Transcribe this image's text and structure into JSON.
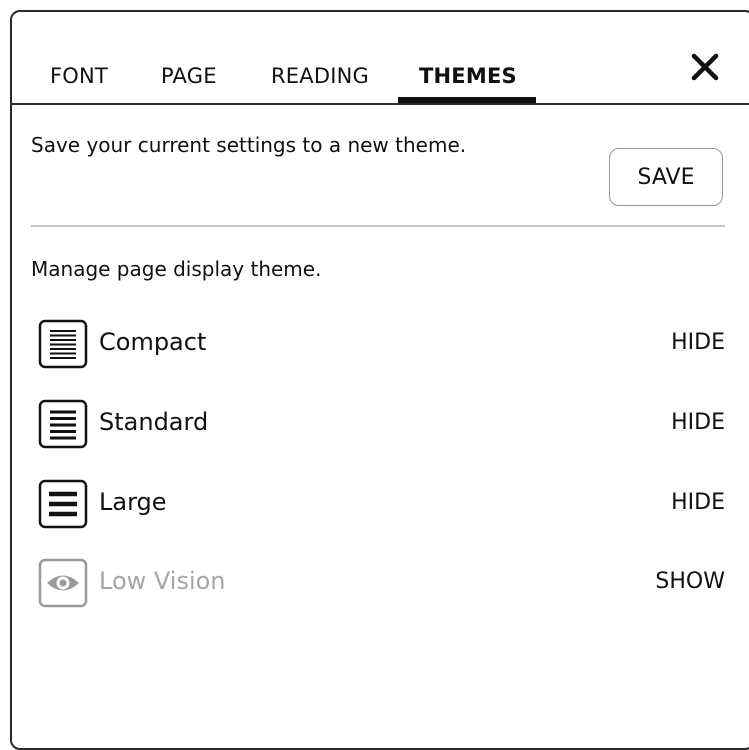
{
  "tabs": [
    {
      "label": "FONT"
    },
    {
      "label": "PAGE"
    },
    {
      "label": "READING"
    },
    {
      "label": "THEMES",
      "active": true
    }
  ],
  "close_icon": "close-icon",
  "save_section": {
    "description": "Save your current settings to a new theme.",
    "button_label": "SAVE"
  },
  "manage_section": {
    "description": "Manage page display theme."
  },
  "themes": [
    {
      "name": "Compact",
      "action": "HIDE",
      "icon": "compact-lines-icon"
    },
    {
      "name": "Standard",
      "action": "HIDE",
      "icon": "standard-lines-icon"
    },
    {
      "name": "Large",
      "action": "HIDE",
      "icon": "large-lines-icon"
    },
    {
      "name": "Low Vision",
      "action": "SHOW",
      "icon": "eye-icon",
      "hidden": true
    }
  ],
  "colors": {
    "text": "#111111",
    "disabled_text": "#a6a6a6",
    "divider": "#c8c8c8"
  }
}
